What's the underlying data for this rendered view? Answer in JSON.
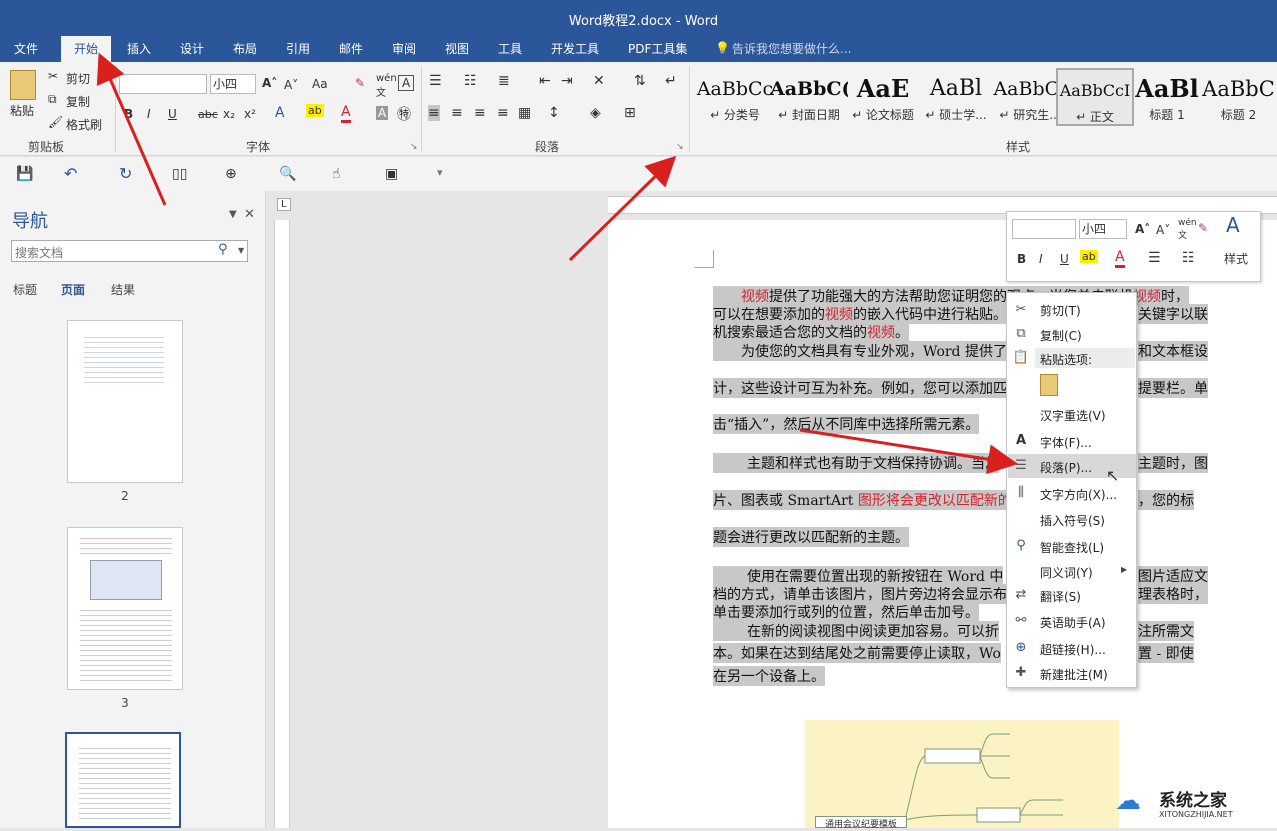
{
  "window": {
    "title": "Word教程2.docx - Word"
  },
  "tabs": [
    "文件",
    "开始",
    "插入",
    "设计",
    "布局",
    "引用",
    "邮件",
    "审阅",
    "视图",
    "工具",
    "开发工具",
    "PDF工具集"
  ],
  "tell_me": "告诉我您想要做什么...",
  "clipboard": {
    "paste": "粘贴",
    "cut": "剪切",
    "copy": "复制",
    "format_painter": "格式刷",
    "group": "剪贴板"
  },
  "font": {
    "name_value": "",
    "size_value": "小四",
    "group": "字体",
    "aa": "Aa",
    "bold": "B",
    "italic": "I",
    "underline": "U",
    "strike": "abc",
    "sub": "x₂",
    "sup": "x²"
  },
  "paragraph": {
    "group": "段落"
  },
  "styles": {
    "group": "样式",
    "items": [
      {
        "sample": "AaBbCc",
        "name": "↵ 分类号"
      },
      {
        "sample": "AaBbC(",
        "name": "↵ 封面日期"
      },
      {
        "sample": "AaE",
        "name": "↵ 论文标题"
      },
      {
        "sample": "AaBl",
        "name": "↵ 硕士学..."
      },
      {
        "sample": "AaBbC(",
        "name": "↵ 研究生..."
      },
      {
        "sample": "AaBbCcI",
        "name": "↵ 正文"
      },
      {
        "sample": "AaBl",
        "name": "标题 1"
      },
      {
        "sample": "AaBbC",
        "name": "标题 2"
      }
    ]
  },
  "nav": {
    "title": "导航",
    "search_placeholder": "搜索文档",
    "tabs": [
      "标题",
      "页面",
      "结果"
    ],
    "pages": [
      "2",
      "3"
    ]
  },
  "document": {
    "p1_l1": [
      "视频",
      "提供了功能强大的方法帮助您证明您的观点。当您单击联机",
      "视频",
      "时，"
    ],
    "p1_l2": [
      "可以在想要添加的",
      "视频",
      "的嵌入代码中进行粘贴。",
      "关键字以联"
    ],
    "p1_l3": [
      "机搜索最适合您的文档的",
      "视频",
      "。"
    ],
    "p2_l1": "为使您的文档具有专业外观，Word 提供了",
    "p2_l1b": "和文本框设",
    "p2_l2": "计，这些设计可互为补充。例如，您可以添加匹",
    "p2_l2b": "提要栏。单",
    "p2_l3": "击“插入”，然后从不同库中选择所需元素。",
    "p3_l1": "主题和样式也有助于文档保持协调。当您",
    "p3_l1b": "主题时，图",
    "p3_l2a": "片、图表或 SmartArt ",
    "p3_l2b": "图形将会更改以匹配新的",
    "p3_l2c": "，您的标",
    "p3_l3": "题会进行更改以匹配新的主题。",
    "p4_l1": "使用在需要位置出现的新按钮在 Word 中",
    "p4_l1b": "图片适应文",
    "p4_l2": "档的方式，请单击该图片，图片旁边将会显示布",
    "p4_l2b": "理表格时，",
    "p4_l3": "单击要添加行或列的位置，然后单击加号。",
    "p5_l1": "在新的阅读视图中阅读更加容易。可以折",
    "p5_l1b": "注所需文",
    "p5_l2": "本。如果在达到结尾处之前需要停止读取，Wo",
    "p5_l2b": "置 - 即使",
    "p5_l3": "在另一个设备上。",
    "mindmap_label": "通用会议纪要模板"
  },
  "mini_toolbar": {
    "size_value": "小四",
    "styles": "样式"
  },
  "context_menu": {
    "items": [
      "剪切(T)",
      "复制(C)",
      "粘贴选项:",
      "汉字重选(V)",
      "字体(F)...",
      "段落(P)...",
      "文字方向(X)...",
      "插入符号(S)",
      "智能查找(L)",
      "同义词(Y)",
      "翻译(S)",
      "英语助手(A)",
      "超链接(H)...",
      "新建批注(M)"
    ]
  },
  "watermark": {
    "name": "系统之家",
    "url": "XITONGZHIJIA.NET"
  },
  "colors": {
    "accent": "#2b579a",
    "arrow": "#d9201f",
    "selection": "#c8c8c8"
  }
}
